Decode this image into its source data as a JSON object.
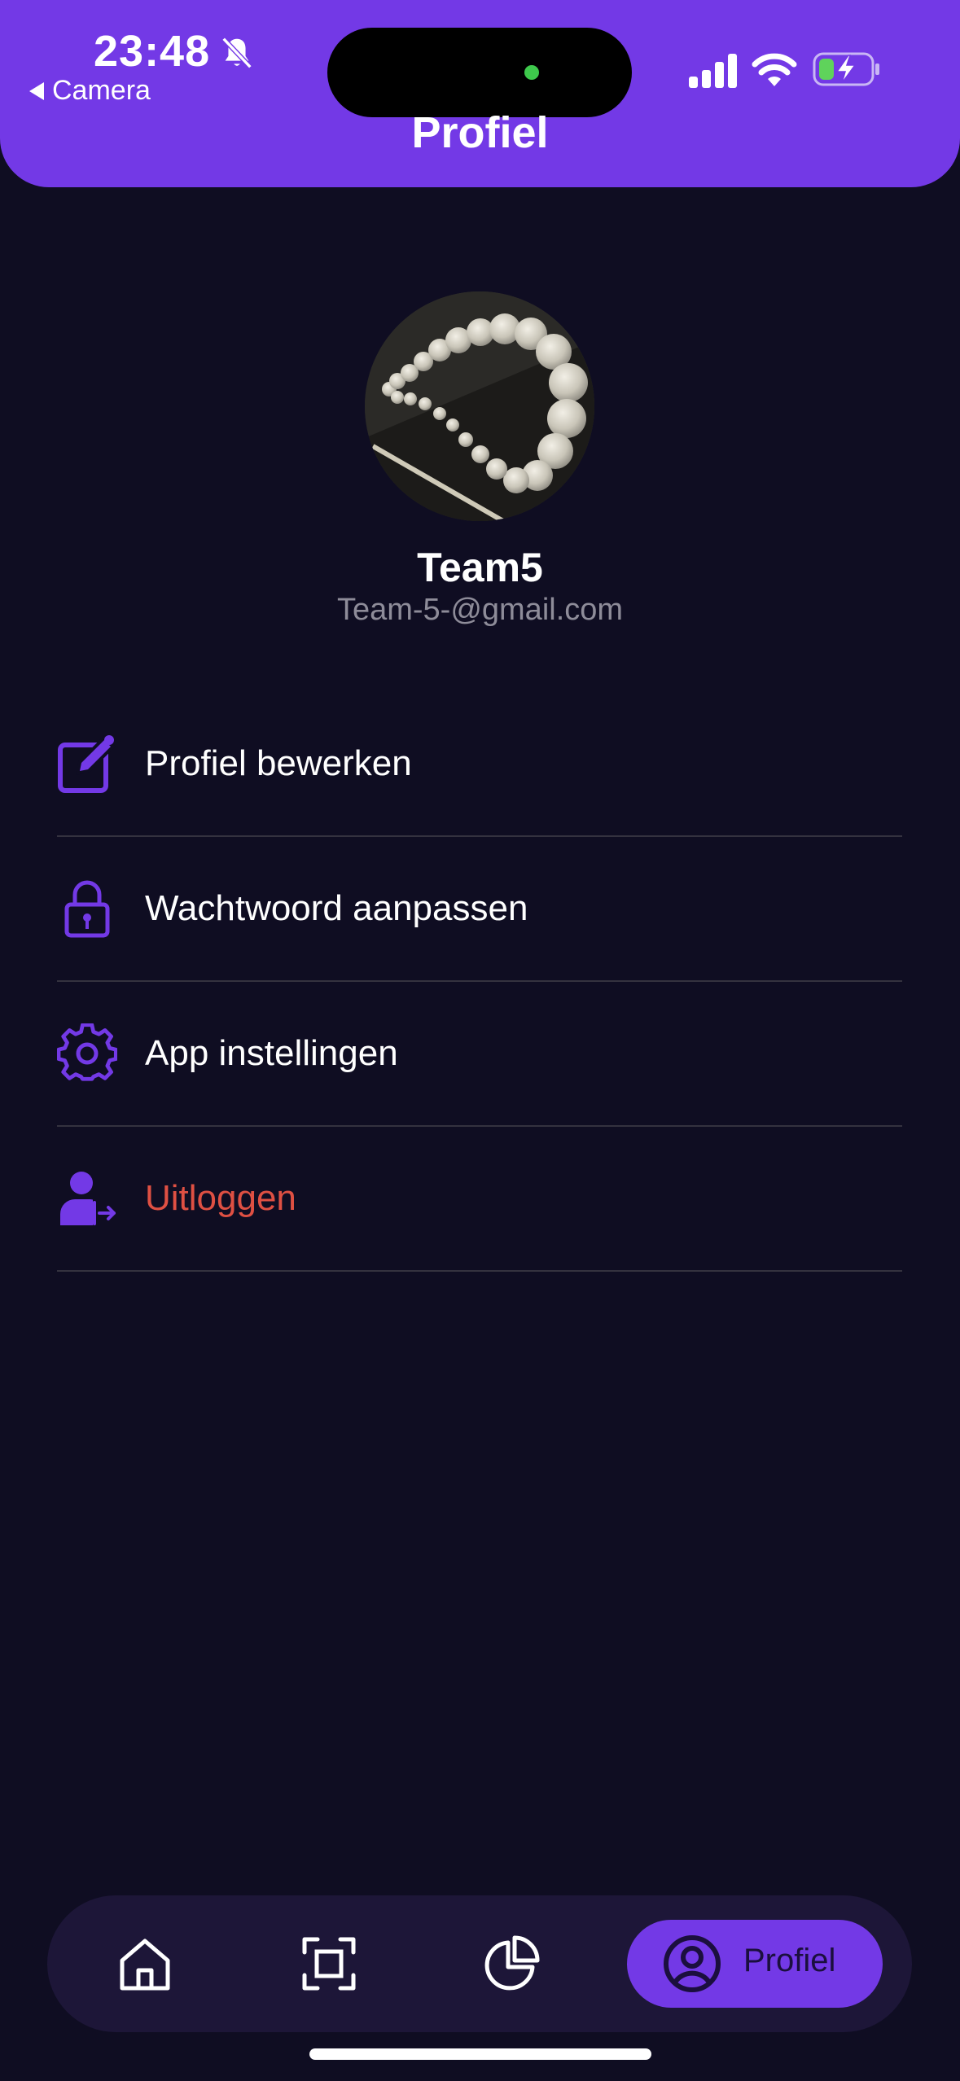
{
  "status_bar": {
    "time": "23:48",
    "back_label": "Camera",
    "icons": [
      "bell-slash-icon",
      "signal-icon",
      "wifi-icon",
      "battery-charging-icon"
    ]
  },
  "header": {
    "title": "Profiel",
    "color": "#7339e6"
  },
  "profile": {
    "name": "Team5",
    "email": "Team-5-@gmail.com"
  },
  "menu": {
    "items": [
      {
        "label": "Profiel bewerken",
        "icon": "edit-icon"
      },
      {
        "label": "Wachtwoord aanpassen",
        "icon": "lock-icon"
      },
      {
        "label": "App instellingen",
        "icon": "gear-icon"
      },
      {
        "label": "Uitloggen",
        "icon": "logout-user-icon",
        "color": "#df5043"
      }
    ]
  },
  "bottom_nav": {
    "items": [
      {
        "icon": "home-icon"
      },
      {
        "icon": "scan-icon"
      },
      {
        "icon": "pie-chart-icon"
      },
      {
        "icon": "profile-icon",
        "label": "Profiel",
        "active": true
      }
    ]
  },
  "colors": {
    "background": "#0f0d22",
    "accent": "#7339e6",
    "danger": "#df5043",
    "nav_background": "#1d1638"
  }
}
